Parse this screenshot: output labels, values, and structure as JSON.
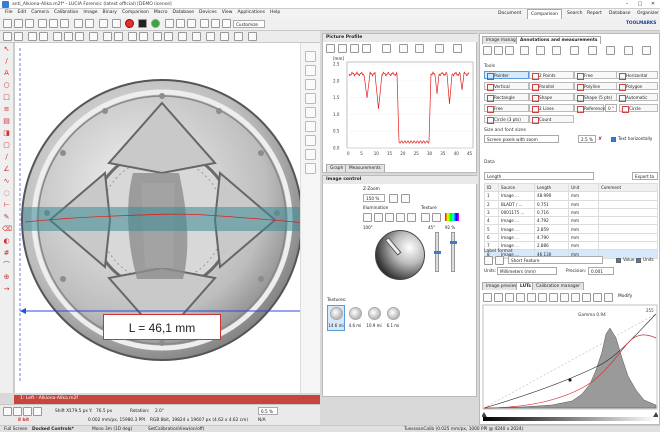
{
  "window": {
    "title": "anti_Alkiona-Alika.m2f* - LUCIA Forensic (latest official) [DEMO license]",
    "min": "–",
    "max": "□",
    "close": "✕"
  },
  "menu": [
    "File",
    "Edit",
    "Camera",
    "Calibration",
    "Image",
    "Binary",
    "Comparison",
    "Macro",
    "Database",
    "Devices",
    "View",
    "Applications",
    "Help"
  ],
  "toolbar1": {
    "customize": "Customize"
  },
  "top_tabs": [
    "Document",
    "Comparison",
    "Search",
    "Report",
    "Database",
    "Organizer"
  ],
  "brand": "TOOLMARKS",
  "image_overlay": {
    "measurement_label": "L = 46,1 mm"
  },
  "file_bar": {
    "title": "1: Left - Alkiona-Alika.m2f"
  },
  "status": {
    "shift_x_label": "Shift X:",
    "shift_x": "179.5 px",
    "shift_y_label": "Y:",
    "shift_y": "76.5 px",
    "rotation_label": "Rotation:",
    "rotation": "2.0°",
    "zoom": "6.5 %",
    "na": "N/A",
    "bit_label": "8 bit",
    "pixel_info": "0.002 mm/px, 15980.3 PPI",
    "rgb_info": "RGB 8bit, 19824 x 19607 px (4.62 x 4.62 cm)",
    "fullscreen": "Full Screen",
    "docked": "Docked Controls*",
    "mono": "Mono 3m (1D deg)",
    "calib": "SetCalibrationView(on/off)",
    "right_info": "TuesssanCalib (0.025 mm/px, 1000 PPI @ 4240 x 2024)"
  },
  "picture_profile": {
    "header": "Picture Profile",
    "y_unit": "[mm]",
    "tabs": [
      "Graph",
      "Measurements"
    ],
    "y_ticks": [
      "2.5",
      "2.0",
      "1.5",
      "1.0",
      "0.5",
      "0.0"
    ],
    "x_ticks": [
      "0",
      "5",
      "10",
      "15",
      "20",
      "25",
      "30",
      "35",
      "40",
      "45"
    ]
  },
  "image_control": {
    "header": "Image control",
    "zzoom_label": "Z-Zoom",
    "zzoom_value": "150 %",
    "illumination_label": "Illumination",
    "texture_label": "Texture",
    "angle_label": "100°",
    "elev_label": "45°",
    "pct_label": "92 %",
    "textures_label": "Textures:",
    "textures": [
      "14.6 mi",
      "4.6 mi",
      "10.9 mi",
      "6.1 mi"
    ]
  },
  "right_panel": {
    "tabs": [
      "Image manager",
      "Annotations and measurements"
    ],
    "tools_label": "Tools",
    "tools": [
      [
        "Pointer",
        "2 Points",
        "Free",
        "Horizontal"
      ],
      [
        "Vertical",
        "Parallel",
        "Polyline",
        "Polygon"
      ],
      [
        "Rectangle",
        "Shape",
        "Shape (5 pts)",
        "Automatic"
      ],
      [
        "Free",
        "2 Lines",
        "Reference",
        "Circle"
      ],
      [
        "Circle (3 pts)",
        "Count",
        "",
        ""
      ]
    ],
    "reference_value": "0 °",
    "sizes_label": "Size and font sizes",
    "screen_pixels": "Screen pixels with zoom",
    "screen_pct": "2.5 %",
    "text_horiz": "Text horizontally",
    "data_label": "Data",
    "data_filter": "Length",
    "export": "Export to",
    "columns": [
      "ID",
      "Source",
      "Length",
      "Unit",
      "Comment"
    ],
    "rows": [
      [
        "1",
        "Image ...",
        "48.990",
        "mm",
        ""
      ],
      [
        "2",
        "BLADT / ...",
        "0.751",
        "mm",
        ""
      ],
      [
        "3",
        "0001175 ...",
        "0.716",
        "mm",
        ""
      ],
      [
        "4",
        "Image ...",
        "4.792",
        "mm",
        ""
      ],
      [
        "5",
        "Image ...",
        "2.859",
        "mm",
        ""
      ],
      [
        "6",
        "Image ...",
        "4.790",
        "mm",
        ""
      ],
      [
        "7",
        "Image ...",
        "2.886",
        "mm",
        ""
      ],
      [
        "8",
        "Image ...",
        "46.130",
        "mm",
        ""
      ]
    ],
    "label_format": "Label format",
    "label_value": "Short Feature",
    "value_chk": "Value",
    "units_chk": "Units",
    "units_label": "Units:",
    "units_value": "Millimeters (mm)",
    "precision_label": "Precision:",
    "precision_value": "0.001",
    "bottom_tabs": [
      "Image preview",
      "LUTs",
      "Calibration manager"
    ],
    "modify": "Modify",
    "gamma": "Gamma 0.94",
    "lut_max": "255"
  },
  "colors": {
    "accent": "#3a7bd5",
    "profile": "#e02020",
    "filebar": "#c6453c",
    "measure": "#2a4cd8"
  }
}
